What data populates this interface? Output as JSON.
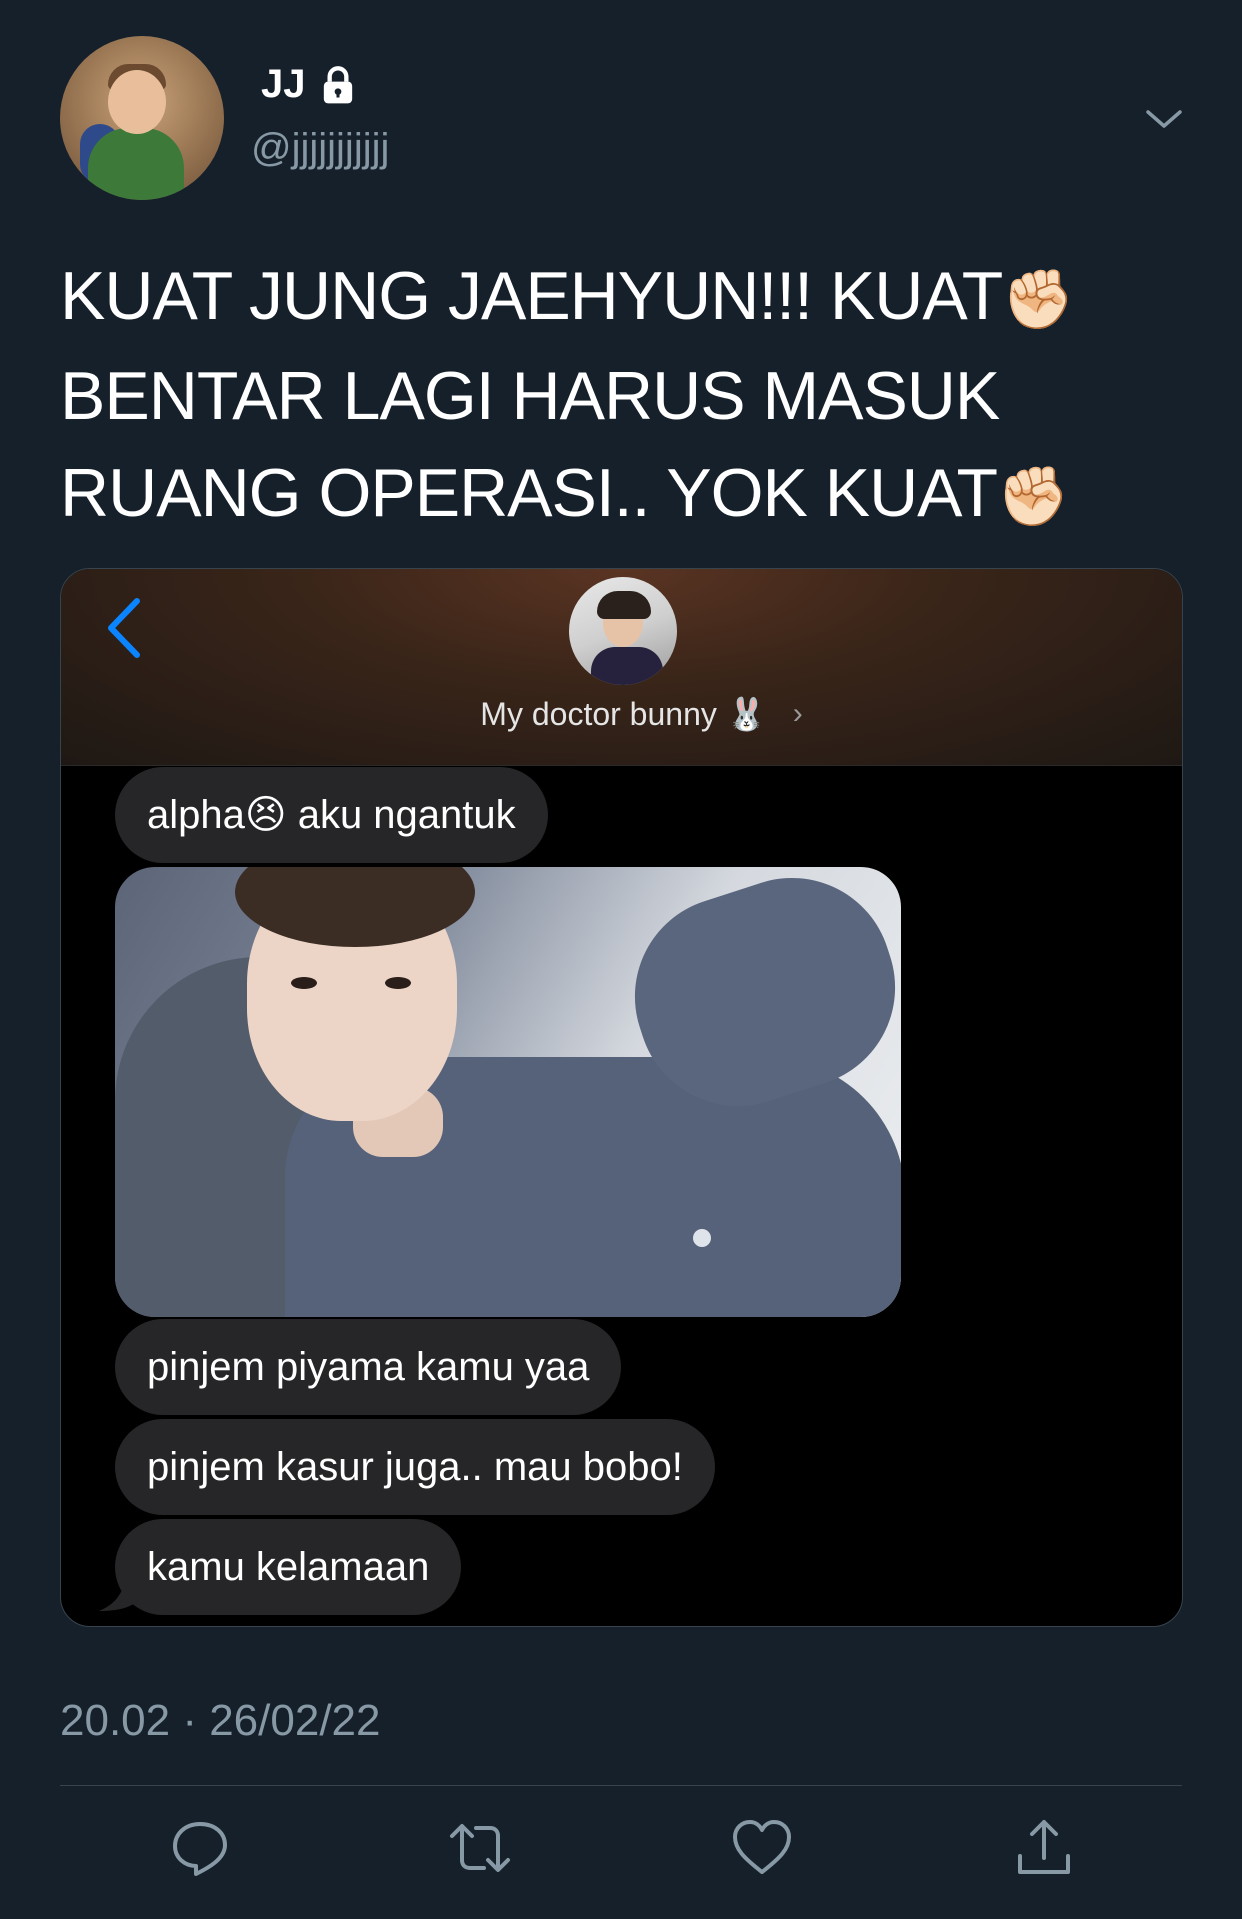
{
  "author": {
    "name": "JJ",
    "handle": "@jjjjjjjjjjj",
    "protected_icon": "lock-icon"
  },
  "tweet": {
    "lines": [
      "KUAT JUNG JAEHYUN!!! KUAT",
      "BENTAR LAGI HARUS MASUK",
      "RUANG OPERASI.. YOK KUAT"
    ],
    "emoji": "✊🏻",
    "timestamp": "20.02 · 26/02/22"
  },
  "chat_screenshot": {
    "contact_name": "My doctor bunny",
    "contact_emoji": "🐰",
    "messages": [
      {
        "text": "alpha",
        "emoji": "😣",
        "text2": " aku ngantuk"
      },
      {
        "text": "pinjem piyama kamu yaa"
      },
      {
        "text": "pinjem kasur juga.. mau bobo!"
      },
      {
        "text": "kamu kelamaan"
      }
    ]
  },
  "actions": [
    "reply-icon",
    "retweet-icon",
    "like-icon",
    "share-icon"
  ],
  "colors": {
    "background": "#15202b",
    "secondary_text": "#8899a6",
    "ios_blue": "#0a84ff",
    "bubble": "#262628"
  }
}
